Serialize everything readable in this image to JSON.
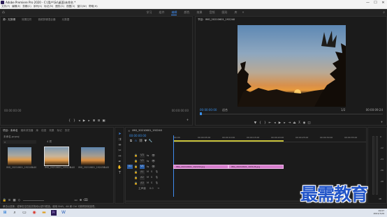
{
  "window": {
    "title": "Adobe Premiere Pro 2020 - C:\\用户\\Ss\\桌面\\未命名 *",
    "minimize": "—",
    "maximize": "☐",
    "close": "✕"
  },
  "menu": [
    "文件(F)",
    "编辑(E)",
    "剪辑(C)",
    "序列(S)",
    "标记(M)",
    "图形(G)",
    "视图(V)",
    "窗口(W)",
    "帮助(H)"
  ],
  "workspaces": {
    "items": [
      "学习",
      "组件",
      "编辑",
      "颜色",
      "效果",
      "音频",
      "图形",
      "库"
    ],
    "active_index": 2,
    "more": "»"
  },
  "source_panel": {
    "tabs": [
      "源：无剪辑",
      "效果控件",
      "音频剪辑混合器",
      "元数据"
    ],
    "timecode_left": "00:00:00:00",
    "timecode_right": "00:00:00:00"
  },
  "program_panel": {
    "tab": "节目：IMG_20210601_192240",
    "timecode": "00:00:00:00",
    "fit": "适合",
    "fraction": "1/2",
    "duration": "00:00:09:24"
  },
  "project_panel": {
    "tabs": [
      "项目：未命名",
      "媒体浏览器",
      "库",
      "信息",
      "效果",
      "标记",
      "历史"
    ],
    "filename": "未命名.prproj",
    "count": "4 项",
    "items": [
      {
        "name": "IMG_20210601_192240...",
        "duration": "5:00"
      },
      {
        "name": "IMG_20210601_193126...",
        "duration": "5:00"
      },
      {
        "name": "IMG_20210601_192458...",
        "duration": "5:00"
      }
    ]
  },
  "timeline": {
    "tab": "IMG_20210601_192240",
    "timecode": "00:00:00:00",
    "ruler": [
      ":00:00",
      "00:00:05:00",
      "00:00:10:00",
      "00:00:15:00",
      "00:00:20:00",
      "00:00:25:00",
      "00:00:30:00",
      "00:00:35:00"
    ],
    "tracks": [
      "V3",
      "V2",
      "V1",
      "A1",
      "A2",
      "A3"
    ],
    "master": "主声道",
    "master_value": "0.0",
    "clips": [
      {
        "label": "IMG_20210601_192240.jpg"
      },
      {
        "label": "IMG_20210601_193126.jpg"
      }
    ]
  },
  "audio_meter": {
    "labels": [
      "0",
      "-12",
      "-24",
      "-36",
      "-48"
    ],
    "unit": "dB"
  },
  "status": "单击以选择，或单击空白处并拖动以进行框选。使用 Shift、Alt 和 Ctrl 可获得其他选项。",
  "taskbar": {
    "time": "19:07",
    "date": "2021/7/29"
  },
  "watermark": "最需教育",
  "colors": {
    "accent": "#3f8cf0",
    "clip": "#d67dcc",
    "timecode": "#3a8ee6"
  }
}
